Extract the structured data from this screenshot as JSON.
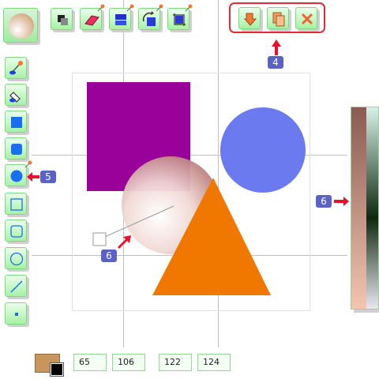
{
  "toolbar_top": {
    "tools": [
      {
        "name": "layer-order-icon"
      },
      {
        "name": "eraser-icon"
      },
      {
        "name": "fill-color-icon"
      },
      {
        "name": "rotate-icon"
      },
      {
        "name": "crop-icon"
      }
    ],
    "actions": [
      {
        "name": "move-down-icon"
      },
      {
        "name": "copy-icon"
      },
      {
        "name": "close-icon"
      }
    ],
    "highlight_color": "#e8283a"
  },
  "side_tools": [
    {
      "name": "line-pen-tool-icon"
    },
    {
      "name": "fill-bucket-tool-icon"
    },
    {
      "name": "filled-rectangle-tool-icon"
    },
    {
      "name": "filled-rounded-rect-tool-icon"
    },
    {
      "name": "filled-ellipse-tool-icon"
    },
    {
      "name": "rectangle-outline-tool-icon"
    },
    {
      "name": "rounded-rect-outline-tool-icon"
    },
    {
      "name": "ellipse-outline-tool-icon"
    },
    {
      "name": "line-tool-icon"
    },
    {
      "name": "point-tool-icon"
    }
  ],
  "annotations": {
    "toolbar_badge": "4",
    "tool_badge": "5",
    "palette_badge": "6",
    "canvas_badge": "6"
  },
  "canvas_shapes": {
    "square_color": "#9a009a",
    "circle_color": "#6b7bef",
    "triangle_color": "#f07800"
  },
  "status": {
    "fields": [
      "65",
      "106",
      "122",
      "124"
    ],
    "primary_color": "#c8965c",
    "secondary_color": "#000000"
  },
  "palette": {
    "left_gradient": [
      "#8b5a52",
      "#f4c4b0"
    ],
    "right_gradient": [
      "#d8f0e8",
      "#102810",
      "#e8e8f0"
    ]
  }
}
